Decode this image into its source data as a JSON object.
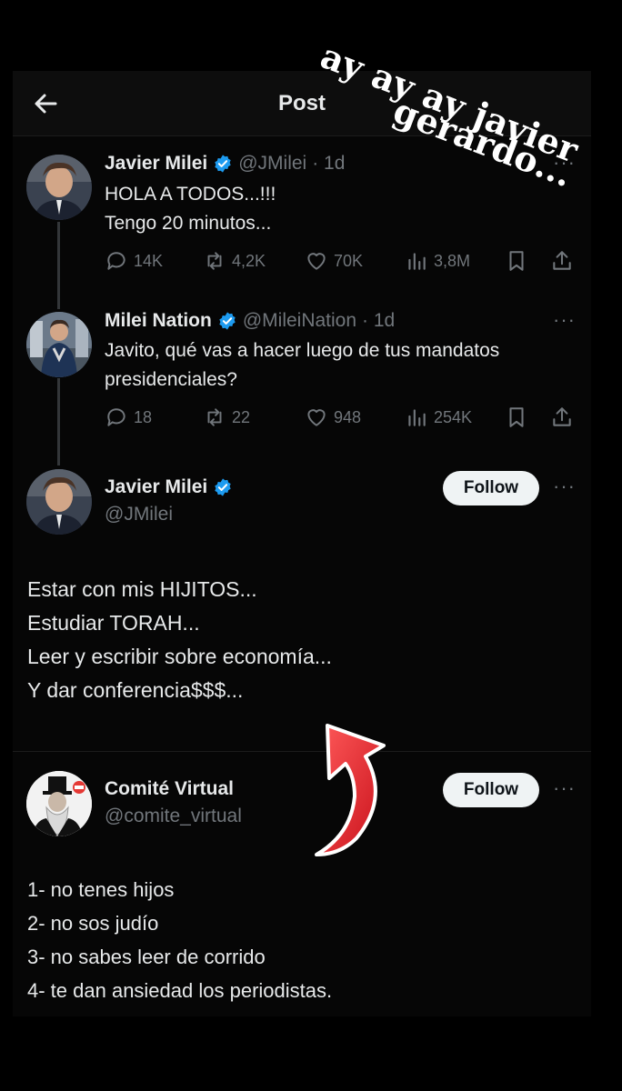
{
  "header": {
    "title": "Post"
  },
  "sticker_text": [
    "ay ay ay javier",
    "gerardo..."
  ],
  "tweet1": {
    "name": "Javier Milei",
    "handle": "@JMilei",
    "time": "· 1d",
    "text": "HOLA A TODOS...!!!\nTengo 20 minutos...",
    "replies": "14K",
    "retweets": "4,2K",
    "likes": "70K",
    "views": "3,8M"
  },
  "tweet2": {
    "name": "Milei Nation",
    "handle": "@MileiNation",
    "time": "· 1d",
    "text": "Javito, qué vas a hacer luego de tus mandatos\npresidenciales?",
    "replies": "18",
    "retweets": "22",
    "likes": "948",
    "views": "254K"
  },
  "tweet3": {
    "name": "Javier Milei",
    "handle": "@JMilei",
    "follow_label": "Follow",
    "lines": [
      "Estar con mis HIJITOS...",
      "Estudiar TORAH...",
      "Leer y escribir sobre economía...",
      "Y dar conferencia$$$..."
    ]
  },
  "tweet4": {
    "name": "Comité Virtual",
    "handle": "@comite_virtual",
    "follow_label": "Follow",
    "lines": [
      "1- no tenes hijos",
      "2- no sos judío",
      "3- no sabes leer de corrido",
      "4- te dan ansiedad los periodistas."
    ]
  },
  "colors": {
    "verified": "#1d9bf0",
    "muted": "#71767b",
    "arrow": "#e8232a"
  }
}
